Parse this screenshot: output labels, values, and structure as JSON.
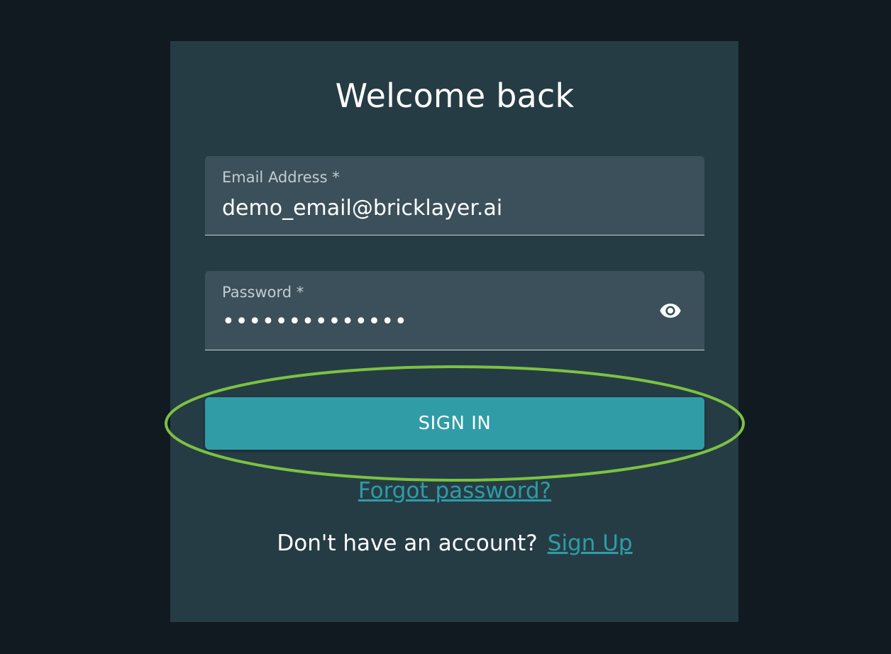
{
  "login": {
    "title": "Welcome back",
    "email": {
      "label": "Email Address *",
      "value": "demo_email@bricklayer.ai"
    },
    "password": {
      "label": "Password *",
      "masked_value": "••••••••••••••",
      "toggle_icon": "eye-icon"
    },
    "sign_in_label": "SIGN IN",
    "forgot_password_label": "Forgot password?",
    "signup_prompt": "Don't have an account?",
    "signup_link_label": "Sign Up"
  },
  "colors": {
    "background": "#101a20",
    "card": "#263c45",
    "field": "#3b505a",
    "accent": "#2f9ca6",
    "highlight": "#7cc242"
  }
}
